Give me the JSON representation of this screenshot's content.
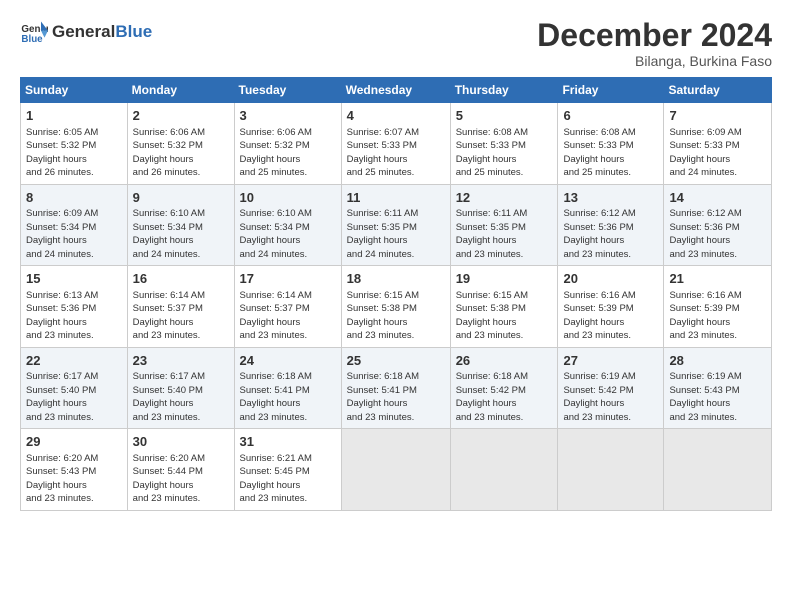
{
  "logo": {
    "text_general": "General",
    "text_blue": "Blue"
  },
  "header": {
    "month": "December 2024",
    "location": "Bilanga, Burkina Faso"
  },
  "weekdays": [
    "Sunday",
    "Monday",
    "Tuesday",
    "Wednesday",
    "Thursday",
    "Friday",
    "Saturday"
  ],
  "weeks": [
    [
      {
        "day": "1",
        "rise": "6:05 AM",
        "set": "5:32 PM",
        "daylight": "11 hours and 26 minutes."
      },
      {
        "day": "2",
        "rise": "6:06 AM",
        "set": "5:32 PM",
        "daylight": "11 hours and 26 minutes."
      },
      {
        "day": "3",
        "rise": "6:06 AM",
        "set": "5:32 PM",
        "daylight": "11 hours and 25 minutes."
      },
      {
        "day": "4",
        "rise": "6:07 AM",
        "set": "5:33 PM",
        "daylight": "11 hours and 25 minutes."
      },
      {
        "day": "5",
        "rise": "6:08 AM",
        "set": "5:33 PM",
        "daylight": "11 hours and 25 minutes."
      },
      {
        "day": "6",
        "rise": "6:08 AM",
        "set": "5:33 PM",
        "daylight": "11 hours and 25 minutes."
      },
      {
        "day": "7",
        "rise": "6:09 AM",
        "set": "5:33 PM",
        "daylight": "11 hours and 24 minutes."
      }
    ],
    [
      {
        "day": "8",
        "rise": "6:09 AM",
        "set": "5:34 PM",
        "daylight": "11 hours and 24 minutes."
      },
      {
        "day": "9",
        "rise": "6:10 AM",
        "set": "5:34 PM",
        "daylight": "11 hours and 24 minutes."
      },
      {
        "day": "10",
        "rise": "6:10 AM",
        "set": "5:34 PM",
        "daylight": "11 hours and 24 minutes."
      },
      {
        "day": "11",
        "rise": "6:11 AM",
        "set": "5:35 PM",
        "daylight": "11 hours and 24 minutes."
      },
      {
        "day": "12",
        "rise": "6:11 AM",
        "set": "5:35 PM",
        "daylight": "11 hours and 23 minutes."
      },
      {
        "day": "13",
        "rise": "6:12 AM",
        "set": "5:36 PM",
        "daylight": "11 hours and 23 minutes."
      },
      {
        "day": "14",
        "rise": "6:12 AM",
        "set": "5:36 PM",
        "daylight": "11 hours and 23 minutes."
      }
    ],
    [
      {
        "day": "15",
        "rise": "6:13 AM",
        "set": "5:36 PM",
        "daylight": "11 hours and 23 minutes."
      },
      {
        "day": "16",
        "rise": "6:14 AM",
        "set": "5:37 PM",
        "daylight": "11 hours and 23 minutes."
      },
      {
        "day": "17",
        "rise": "6:14 AM",
        "set": "5:37 PM",
        "daylight": "11 hours and 23 minutes."
      },
      {
        "day": "18",
        "rise": "6:15 AM",
        "set": "5:38 PM",
        "daylight": "11 hours and 23 minutes."
      },
      {
        "day": "19",
        "rise": "6:15 AM",
        "set": "5:38 PM",
        "daylight": "11 hours and 23 minutes."
      },
      {
        "day": "20",
        "rise": "6:16 AM",
        "set": "5:39 PM",
        "daylight": "11 hours and 23 minutes."
      },
      {
        "day": "21",
        "rise": "6:16 AM",
        "set": "5:39 PM",
        "daylight": "11 hours and 23 minutes."
      }
    ],
    [
      {
        "day": "22",
        "rise": "6:17 AM",
        "set": "5:40 PM",
        "daylight": "11 hours and 23 minutes."
      },
      {
        "day": "23",
        "rise": "6:17 AM",
        "set": "5:40 PM",
        "daylight": "11 hours and 23 minutes."
      },
      {
        "day": "24",
        "rise": "6:18 AM",
        "set": "5:41 PM",
        "daylight": "11 hours and 23 minutes."
      },
      {
        "day": "25",
        "rise": "6:18 AM",
        "set": "5:41 PM",
        "daylight": "11 hours and 23 minutes."
      },
      {
        "day": "26",
        "rise": "6:18 AM",
        "set": "5:42 PM",
        "daylight": "11 hours and 23 minutes."
      },
      {
        "day": "27",
        "rise": "6:19 AM",
        "set": "5:42 PM",
        "daylight": "11 hours and 23 minutes."
      },
      {
        "day": "28",
        "rise": "6:19 AM",
        "set": "5:43 PM",
        "daylight": "11 hours and 23 minutes."
      }
    ],
    [
      {
        "day": "29",
        "rise": "6:20 AM",
        "set": "5:43 PM",
        "daylight": "11 hours and 23 minutes."
      },
      {
        "day": "30",
        "rise": "6:20 AM",
        "set": "5:44 PM",
        "daylight": "11 hours and 23 minutes."
      },
      {
        "day": "31",
        "rise": "6:21 AM",
        "set": "5:45 PM",
        "daylight": "11 hours and 23 minutes."
      },
      null,
      null,
      null,
      null
    ]
  ]
}
